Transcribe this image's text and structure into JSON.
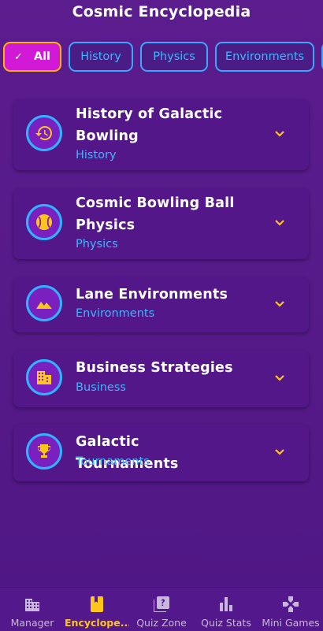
{
  "header": {
    "title": "Cosmic Encyclopedia"
  },
  "filters": [
    {
      "label": "All",
      "selected": true
    },
    {
      "label": "History",
      "selected": false
    },
    {
      "label": "Physics",
      "selected": false
    },
    {
      "label": "Environments",
      "selected": false
    }
  ],
  "cards": [
    {
      "title": "History of Galactic Bowling",
      "category": "History",
      "icon": "history-icon"
    },
    {
      "title": "Cosmic Bowling Ball Physics",
      "category": "Physics",
      "icon": "bowling-ball-icon"
    },
    {
      "title": "Lane Environments",
      "category": "Environments",
      "icon": "landscape-icon"
    },
    {
      "title": "Business Strategies",
      "category": "Business",
      "icon": "business-icon"
    },
    {
      "title": "Galactic Tournaments",
      "category": "Tournaments",
      "icon": "trophy-icon"
    }
  ],
  "nav": [
    {
      "label": "Manager",
      "icon": "manager-icon",
      "active": false
    },
    {
      "label": "Encyclope...",
      "icon": "encyclopedia-icon",
      "active": true
    },
    {
      "label": "Quiz Zone",
      "icon": "quiz-icon",
      "active": false
    },
    {
      "label": "Quiz Stats",
      "icon": "stats-icon",
      "active": false
    },
    {
      "label": "Mini Games",
      "icon": "gamepad-icon",
      "active": false
    }
  ],
  "colors": {
    "background": "#5a1a8c",
    "accent_blue": "#3fb6ff",
    "accent_magenta": "#d21ad6",
    "accent_yellow": "#ffc61a"
  }
}
